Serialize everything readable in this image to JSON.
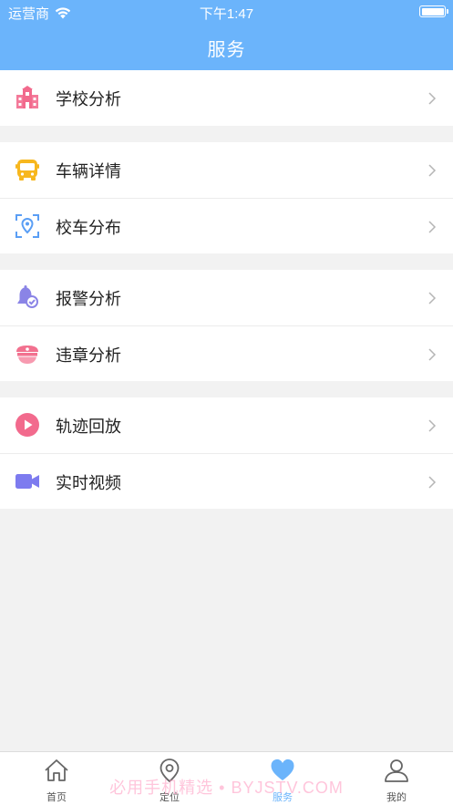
{
  "status_bar": {
    "carrier": "运营商",
    "time": "下午1:47"
  },
  "header": {
    "title": "服务"
  },
  "groups": [
    {
      "items": [
        {
          "label": "学校分析",
          "icon": "school-icon"
        }
      ]
    },
    {
      "items": [
        {
          "label": "车辆详情",
          "icon": "bus-icon"
        },
        {
          "label": "校车分布",
          "icon": "location-scan-icon"
        }
      ]
    },
    {
      "items": [
        {
          "label": "报警分析",
          "icon": "alarm-bell-icon"
        },
        {
          "label": "违章分析",
          "icon": "police-cap-icon"
        }
      ]
    },
    {
      "items": [
        {
          "label": "轨迹回放",
          "icon": "play-icon"
        },
        {
          "label": "实时视频",
          "icon": "video-camera-icon"
        }
      ]
    }
  ],
  "tabbar": {
    "tabs": [
      {
        "label": "首页",
        "icon": "home-icon"
      },
      {
        "label": "定位",
        "icon": "location-pin-icon"
      },
      {
        "label": "服务",
        "icon": "heart-icon",
        "active": true
      },
      {
        "label": "我的",
        "icon": "user-icon"
      }
    ]
  },
  "watermark": "必用手机精选 • BYJSTV.COM",
  "colors": {
    "header": "#6bb4fb",
    "background": "#f2f2f2",
    "active_tab": "#6bb4fb"
  }
}
